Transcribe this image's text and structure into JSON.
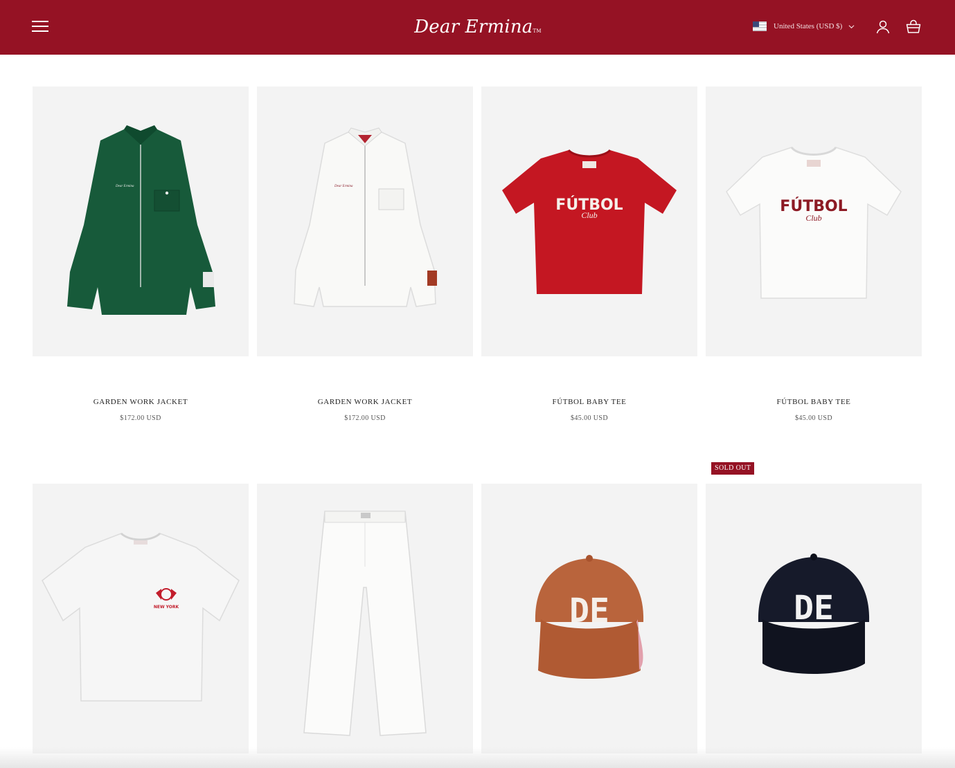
{
  "header": {
    "brand": "Dear Ermina",
    "brand_mark": "TM",
    "country_selector": "United States (USD $)",
    "colors": {
      "background": "#951224",
      "text": "#ffffff"
    },
    "icons": [
      "menu-icon",
      "us-flag-icon",
      "chevron-down-icon",
      "account-icon",
      "cart-icon"
    ]
  },
  "products": [
    {
      "title": "GARDEN WORK JACKET",
      "price": "$172.00 USD",
      "image": "green-work-jacket"
    },
    {
      "title": "GARDEN WORK JACKET",
      "price": "$172.00 USD",
      "image": "white-work-jacket"
    },
    {
      "title": "FÚTBOL BABY TEE",
      "price": "$45.00 USD",
      "image": "red-baby-tee",
      "print_line1": "FÚTBOL",
      "print_line2": "Club"
    },
    {
      "title": "FÚTBOL BABY TEE",
      "price": "$45.00 USD",
      "image": "white-baby-tee",
      "print_line1": "FÚTBOL",
      "print_line2": "Club"
    },
    {
      "title": "",
      "price": "",
      "image": "white-crest-tee",
      "print_line1": "NEW YORK"
    },
    {
      "title": "",
      "price": "",
      "image": "white-pants"
    },
    {
      "title": "",
      "price": "",
      "image": "brown-de-cap",
      "print_line1": "DE"
    },
    {
      "title": "",
      "price": "",
      "image": "navy-de-cap",
      "print_line1": "DE",
      "badge": "SOLD OUT"
    }
  ],
  "colors": {
    "accent": "#951224",
    "image_bg": "#f3f3f3"
  }
}
